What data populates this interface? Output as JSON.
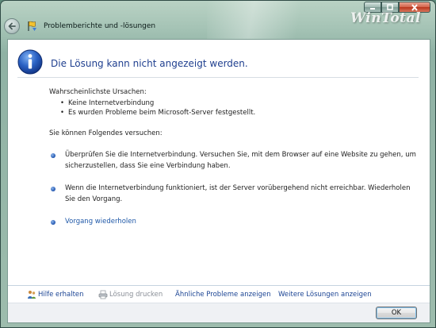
{
  "window": {
    "title": "Problemberichte und -lösungen",
    "watermark": "WinTotal"
  },
  "caption_buttons": {
    "minimize": "minimize-icon",
    "maximize": "maximize-icon",
    "close": "close-icon"
  },
  "main": {
    "heading": "Die Lösung kann nicht angezeigt werden.",
    "causes_heading": "Wahrscheinlichste Ursachen:",
    "causes": [
      "Keine Internetverbindung",
      "Es wurden Probleme beim Microsoft-Server festgestellt."
    ],
    "try_heading": "Sie können Folgendes versuchen:",
    "options": [
      "Überprüfen Sie die Internetverbindung. Versuchen Sie, mit dem Browser auf eine Website zu gehen, um sicherzustellen, dass Sie eine Verbindung haben.",
      "Wenn die Internetverbindung funktioniert, ist der Server vorübergehend nicht erreichbar. Wiederholen Sie den Vorgang."
    ],
    "retry_link": "Vorgang wiederholen"
  },
  "tasks": {
    "help": "Hilfe erhalten",
    "print": "Lösung drucken",
    "similar": "Ähnliche Probleme anzeigen",
    "more": "Weitere Lösungen anzeigen"
  },
  "footer": {
    "ok_label": "OK"
  },
  "colors": {
    "heading": "#1f3f8f",
    "link": "#1f58a8",
    "info_icon": "#1e4fa8",
    "close_button": "#c8452a"
  }
}
